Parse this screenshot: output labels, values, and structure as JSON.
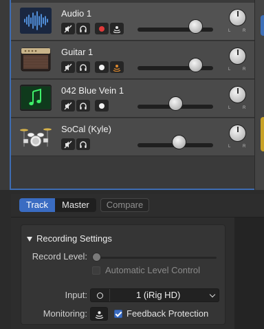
{
  "colors": {
    "accent_blue": "#3a6cc2",
    "record_red": "#e03a3a",
    "monitor_orange": "#e08a2e",
    "background": "#2b2b2b"
  },
  "tracks": [
    {
      "name": "Audio 1",
      "icon": "audio-waveform-icon",
      "selected": true,
      "buttons": [
        "mute-icon",
        "headphones-solo-icon",
        "record-enable-button",
        "input-monitor-icon"
      ],
      "record_armed": true,
      "monitoring_active": false,
      "volume": 0.79,
      "pan_labels": [
        "L",
        "R"
      ]
    },
    {
      "name": "Guitar 1",
      "icon": "guitar-amp-icon",
      "selected": false,
      "buttons": [
        "mute-icon",
        "headphones-solo-icon",
        "record-enable-button",
        "input-monitor-icon"
      ],
      "record_armed": false,
      "monitoring_active": true,
      "volume": 0.79,
      "pan_labels": [
        "L",
        "R"
      ]
    },
    {
      "name": "042 Blue Vein 1",
      "icon": "music-note-icon",
      "selected": false,
      "buttons": [
        "mute-icon",
        "headphones-solo-icon",
        "record-enable-button"
      ],
      "record_armed": false,
      "volume": 0.52,
      "pan_labels": [
        "L",
        "R"
      ]
    },
    {
      "name": "SoCal (Kyle)",
      "icon": "drum-kit-icon",
      "selected": false,
      "buttons": [
        "mute-icon",
        "headphones-solo-icon"
      ],
      "volume": 0.56,
      "pan_labels": [
        "L",
        "R"
      ]
    }
  ],
  "panel": {
    "tabs": [
      "Track",
      "Master"
    ],
    "active_tab": "Track",
    "compare_label": "Compare",
    "section_title": "Recording Settings",
    "record_level_label": "Record Level:",
    "record_level_value": 0.0,
    "auto_level_label": "Automatic Level Control",
    "auto_level_checked": false,
    "input_label": "Input:",
    "input_value": "1  (iRig HD)",
    "monitoring_label": "Monitoring:",
    "feedback_label": "Feedback Protection",
    "feedback_checked": true
  }
}
